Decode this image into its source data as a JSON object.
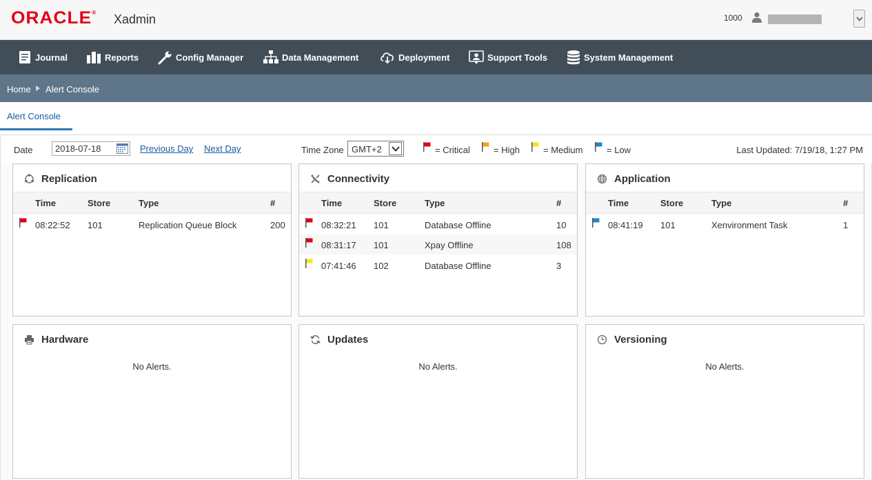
{
  "header": {
    "logo_text": "ORACLE",
    "app_name": "Xadmin",
    "user_store": "1000"
  },
  "nav": {
    "items": [
      {
        "label": "Journal",
        "icon": "journal-icon"
      },
      {
        "label": "Reports",
        "icon": "reports-icon"
      },
      {
        "label": "Config Manager",
        "icon": "wrench-icon"
      },
      {
        "label": "Data Management",
        "icon": "hierarchy-icon"
      },
      {
        "label": "Deployment",
        "icon": "cloud-download-icon"
      },
      {
        "label": "Support Tools",
        "icon": "support-icon"
      },
      {
        "label": "System Management",
        "icon": "database-icon"
      }
    ]
  },
  "breadcrumb": {
    "home": "Home",
    "current": "Alert Console"
  },
  "tabs": [
    {
      "label": "Alert Console",
      "active": true
    }
  ],
  "toolbar": {
    "date_label": "Date",
    "date_value": "2018-07-18",
    "prev_day": "Previous Day",
    "next_day": "Next Day",
    "timezone_label": "Time Zone",
    "timezone_value": "GMT+2",
    "legend": [
      {
        "label": "= Critical",
        "color": "#e2001a"
      },
      {
        "label": "= High",
        "color": "#f5a31a"
      },
      {
        "label": "= Medium",
        "color": "#f7e51e"
      },
      {
        "label": "= Low",
        "color": "#1f87c7"
      }
    ],
    "last_updated": "Last Updated: 7/19/18, 1:27 PM"
  },
  "columns": [
    "Time",
    "Store",
    "Type",
    "#"
  ],
  "panels": {
    "replication": {
      "title": "Replication",
      "icon": "replication-icon",
      "rows": [
        {
          "severity": "critical",
          "time": "08:22:52",
          "store": "101",
          "type": "Replication Queue Block",
          "count": "200"
        }
      ]
    },
    "connectivity": {
      "title": "Connectivity",
      "icon": "connectivity-icon",
      "rows": [
        {
          "severity": "critical",
          "time": "08:32:21",
          "store": "101",
          "type": "Database Offline",
          "count": "10"
        },
        {
          "severity": "critical",
          "time": "08:31:17",
          "store": "101",
          "type": "Xpay Offline",
          "count": "108"
        },
        {
          "severity": "medium",
          "time": "07:41:46",
          "store": "102",
          "type": "Database Offline",
          "count": "3"
        }
      ]
    },
    "application": {
      "title": "Application",
      "icon": "globe-icon",
      "rows": [
        {
          "severity": "low",
          "time": "08:41:19",
          "store": "101",
          "type": "Xenvironment Task",
          "count": "1"
        }
      ]
    },
    "hardware": {
      "title": "Hardware",
      "icon": "printer-icon",
      "message": "No Alerts."
    },
    "updates": {
      "title": "Updates",
      "icon": "refresh-icon",
      "message": "No Alerts."
    },
    "versioning": {
      "title": "Versioning",
      "icon": "clock-icon",
      "message": "No Alerts."
    }
  }
}
